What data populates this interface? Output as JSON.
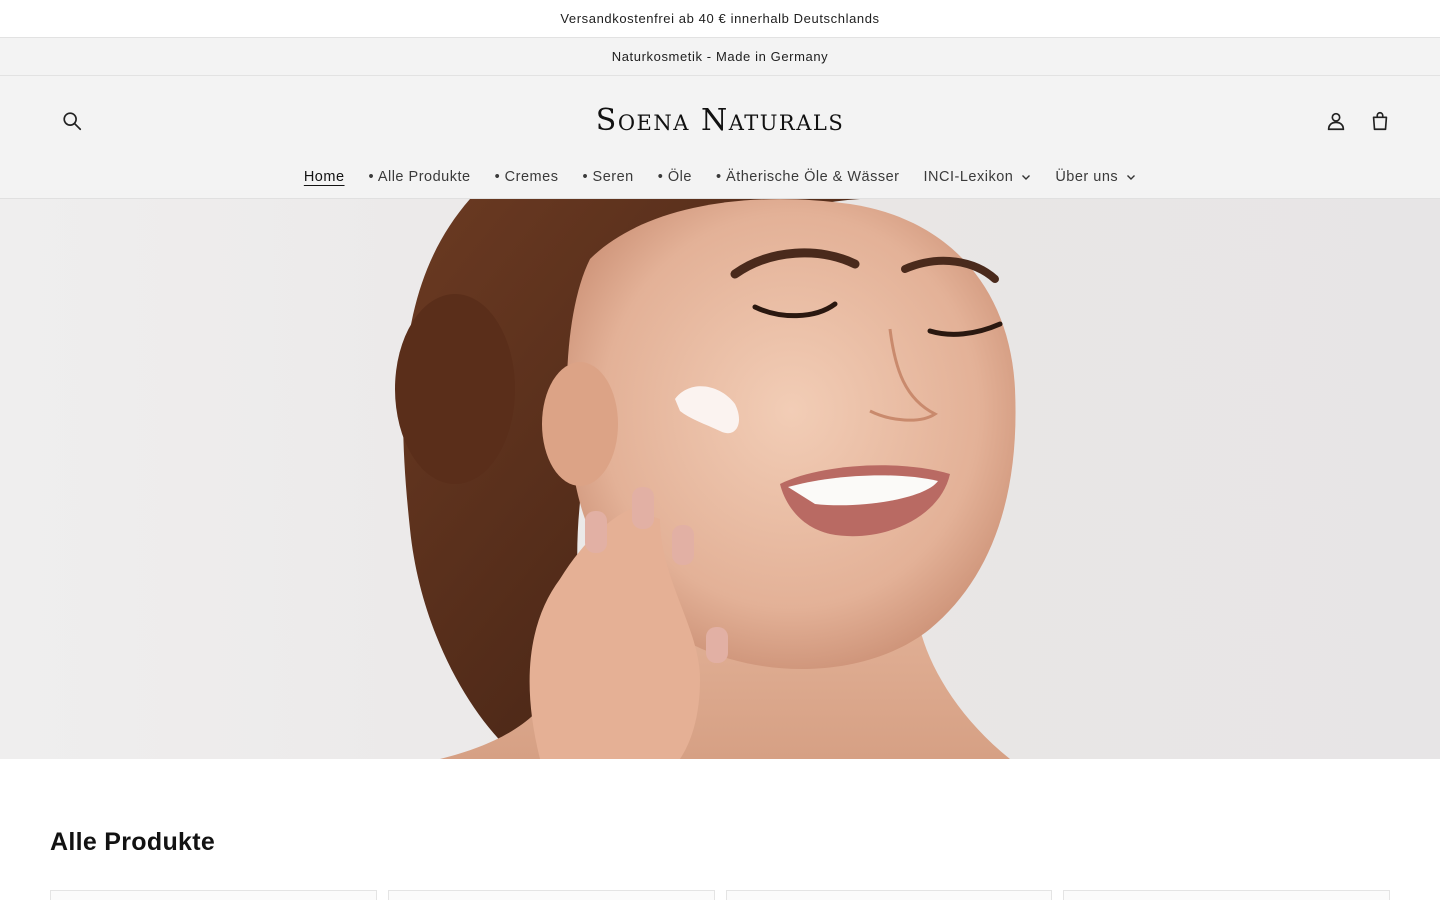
{
  "announcements": {
    "primary": "Versandkostenfrei ab 40 € innerhalb Deutschlands",
    "secondary": "Naturkosmetik - Made in Germany"
  },
  "header": {
    "logo": "Soena Naturals",
    "icons": {
      "search": "search-icon",
      "account": "account-icon",
      "cart": "cart-icon"
    }
  },
  "nav": {
    "items": [
      {
        "label": "Home",
        "active": true
      },
      {
        "label": "• Alle Produkte"
      },
      {
        "label": "• Cremes"
      },
      {
        "label": "• Seren"
      },
      {
        "label": "• Öle"
      },
      {
        "label": "• Ätherische Öle & Wässer"
      },
      {
        "label": "INCI-Lexikon",
        "dropdown": true
      },
      {
        "label": "Über uns",
        "dropdown": true
      }
    ]
  },
  "main": {
    "section_title": "Alle Produkte"
  },
  "colors": {
    "header_bg": "#f3f3f3",
    "text": "#121212",
    "hero_bg": "#ebe9e9"
  }
}
